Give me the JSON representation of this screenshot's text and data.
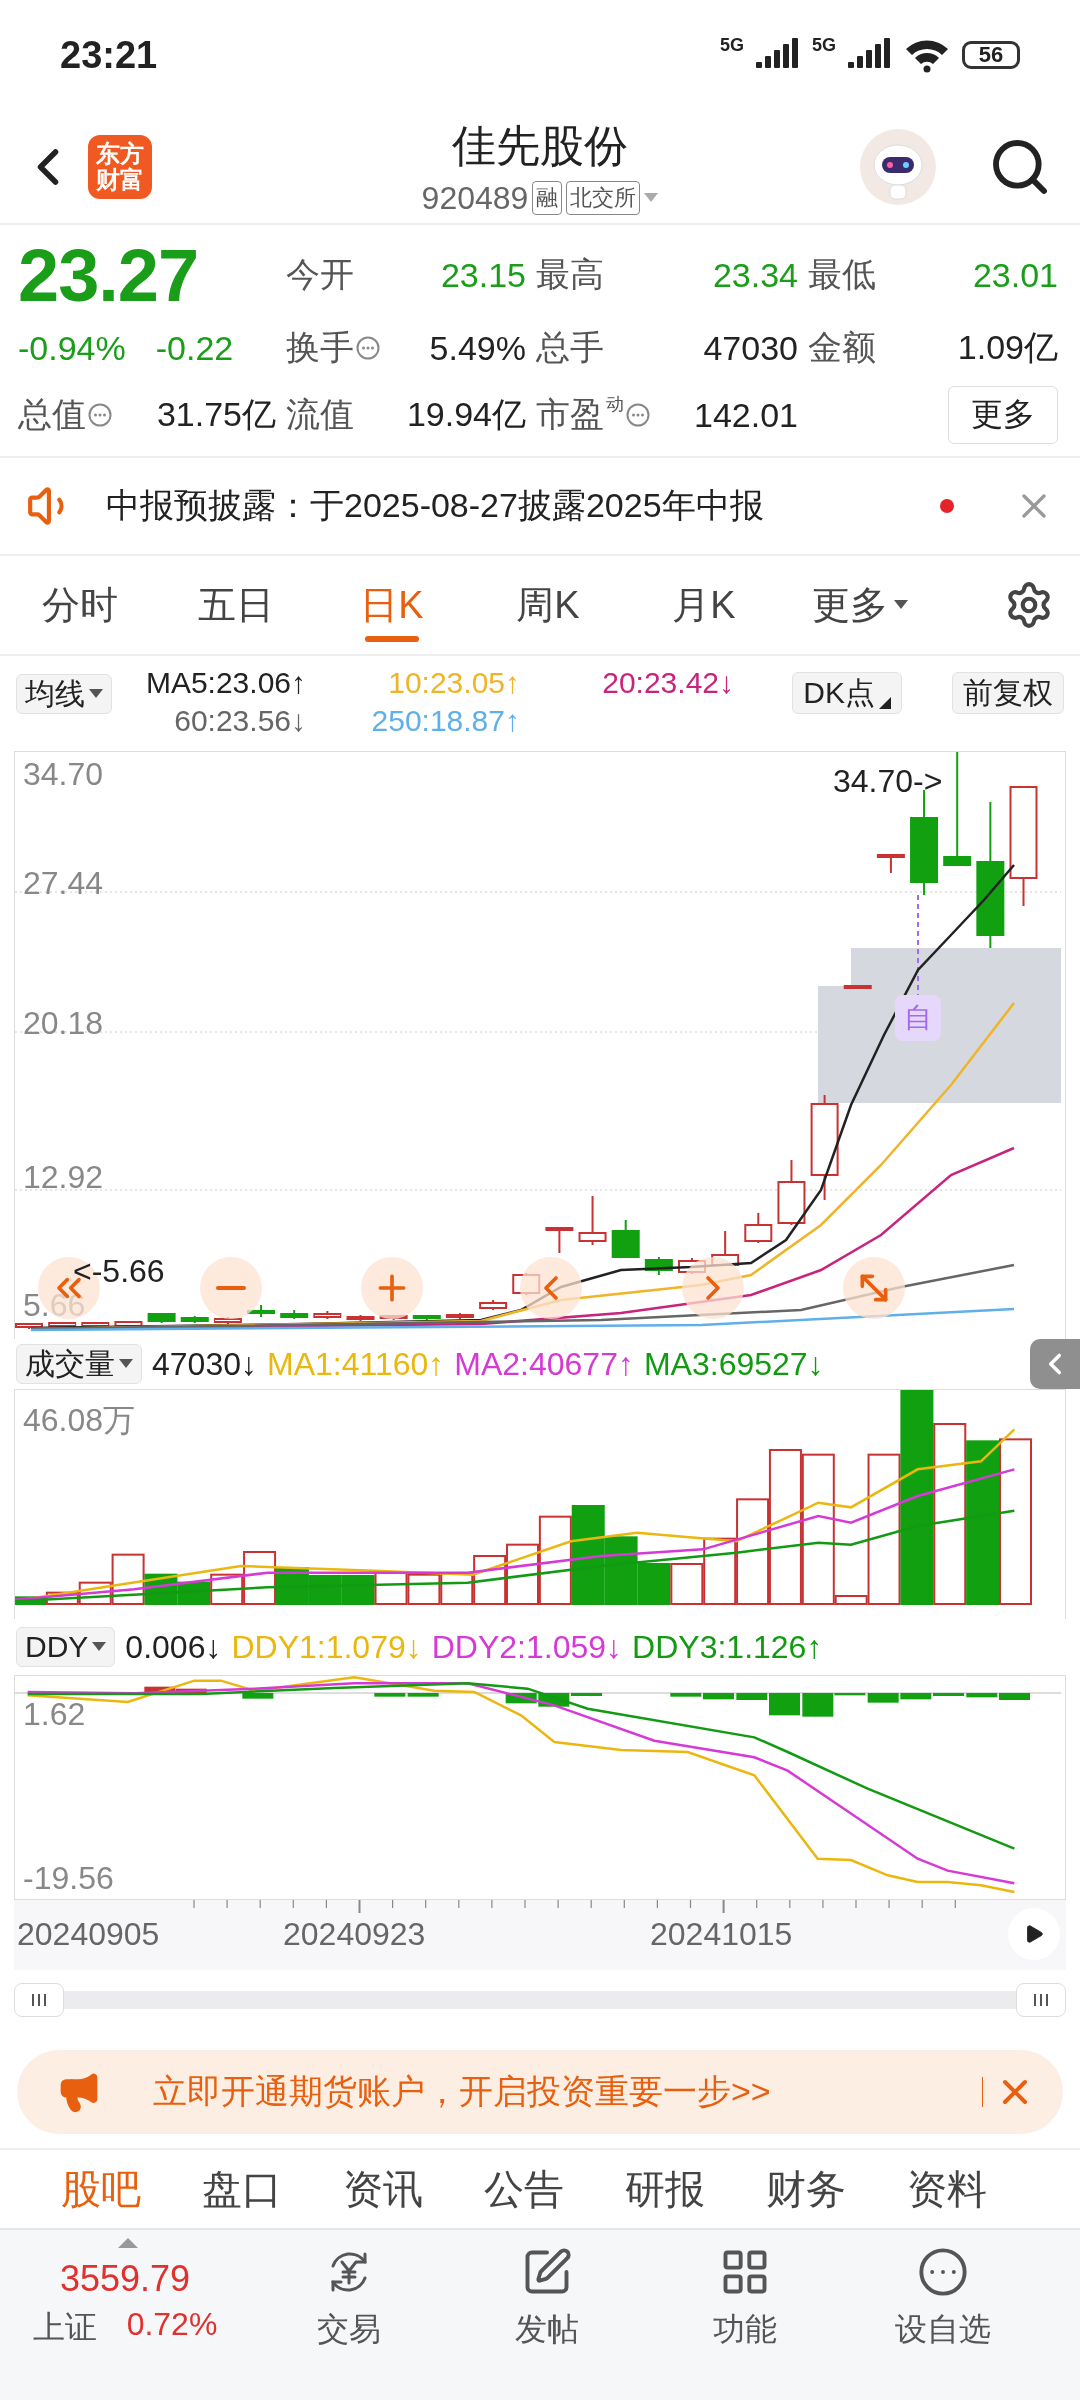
{
  "status_bar": {
    "time": "23:21",
    "networks": [
      "5G",
      "5G"
    ],
    "battery": "56"
  },
  "header": {
    "logo": "东方财富",
    "title": "佳先股份",
    "code": "920489",
    "badges": [
      "融",
      "北交所"
    ]
  },
  "quote": {
    "price": "23.27",
    "change_pct": "-0.94%",
    "change": "-0.22",
    "color": "#1a9e1a",
    "fields": [
      {
        "label": "今开",
        "value": "23.15",
        "color": "#1a9e1a",
        "info": false
      },
      {
        "label": "最高",
        "value": "23.34",
        "color": "#1a9e1a",
        "info": false
      },
      {
        "label": "最低",
        "value": "23.01",
        "color": "#1a9e1a",
        "info": false
      },
      {
        "label": "换手",
        "value": "5.49%",
        "color": "#222222",
        "info": true
      },
      {
        "label": "总手",
        "value": "47030",
        "color": "#222222",
        "info": false
      },
      {
        "label": "金额",
        "value": "1.09亿",
        "color": "#222222",
        "info": false
      },
      {
        "label": "总值",
        "value": "31.75亿",
        "color": "#222222",
        "info": true
      },
      {
        "label": "流值",
        "value": "19.94亿",
        "color": "#222222",
        "info": false
      },
      {
        "label": "市盈",
        "superscript": "动",
        "value": "142.01",
        "color": "#222222",
        "info": true
      }
    ],
    "more_button": "更多"
  },
  "notice": {
    "text": "中报预披露：于2025-08-27披露2025年中报",
    "unread": true
  },
  "period_tabs": [
    {
      "label": "分时",
      "selected": false,
      "kind": "plain"
    },
    {
      "label": "五日",
      "selected": false,
      "kind": "plain"
    },
    {
      "label": "日K",
      "selected": true,
      "kind": "plain"
    },
    {
      "label": "周K",
      "selected": false,
      "kind": "plain"
    },
    {
      "label": "月K",
      "selected": false,
      "kind": "plain"
    },
    {
      "label": "更多",
      "selected": false,
      "kind": "dropdown"
    }
  ],
  "kline": {
    "indicator": "均线",
    "legend": [
      {
        "text": "MA5:23.06↑",
        "color": "#222222"
      },
      {
        "text": "10:23.05↑",
        "color": "#f0b429"
      },
      {
        "text": "20:23.42↓",
        "color": "#c8247d"
      },
      {
        "text": "60:23.56↓",
        "color": "#666666"
      },
      {
        "text": "250:18.87↑",
        "color": "#5fb0ea"
      }
    ],
    "dk_button": "DK点",
    "adjust_button": "前复权",
    "y_labels": [
      "34.70",
      "27.44",
      "20.18",
      "12.92",
      "5.66"
    ],
    "high_marker": "34.70->",
    "low_marker": "<-5.66",
    "signal_badge": "自"
  },
  "volume": {
    "indicator": "成交量",
    "legend": [
      {
        "text": "47030↓",
        "color": "#222222"
      },
      {
        "text": "MA1:41160↑",
        "color": "#ebb70e"
      },
      {
        "text": "MA2:40677↑",
        "color": "#d63ad6"
      },
      {
        "text": "MA3:69527↓",
        "color": "#139a13"
      }
    ],
    "y_label": "46.08万"
  },
  "ddy": {
    "indicator": "DDY",
    "legend": [
      {
        "text": "0.006↓",
        "color": "#222222"
      },
      {
        "text": "DDY1:1.079↓",
        "color": "#ebb70e"
      },
      {
        "text": "DDY2:1.059↓",
        "color": "#d63ad6"
      },
      {
        "text": "DDY3:1.126↑",
        "color": "#139a13"
      }
    ],
    "y_labels": [
      "1.62",
      "-19.56"
    ]
  },
  "dates": [
    "20240905",
    "20240923",
    "20241015"
  ],
  "banner": {
    "text": "立即开通期货账户，开启投资重要一步>>"
  },
  "info_tabs": [
    {
      "label": "股吧",
      "selected": true
    },
    {
      "label": "盘口",
      "selected": false
    },
    {
      "label": "资讯",
      "selected": false
    },
    {
      "label": "公告",
      "selected": false
    },
    {
      "label": "研报",
      "selected": false
    },
    {
      "label": "财务",
      "selected": false
    },
    {
      "label": "资料",
      "selected": false
    }
  ],
  "bottom_nav": {
    "index": {
      "value": "3559.79",
      "name": "上证",
      "change_pct": "0.72%",
      "color": "#e0312f"
    },
    "items": [
      {
        "label": "交易",
        "kind": "trade"
      },
      {
        "label": "发帖",
        "kind": "post"
      },
      {
        "label": "功能",
        "kind": "apps"
      },
      {
        "label": "设自选",
        "kind": "more"
      }
    ]
  }
}
